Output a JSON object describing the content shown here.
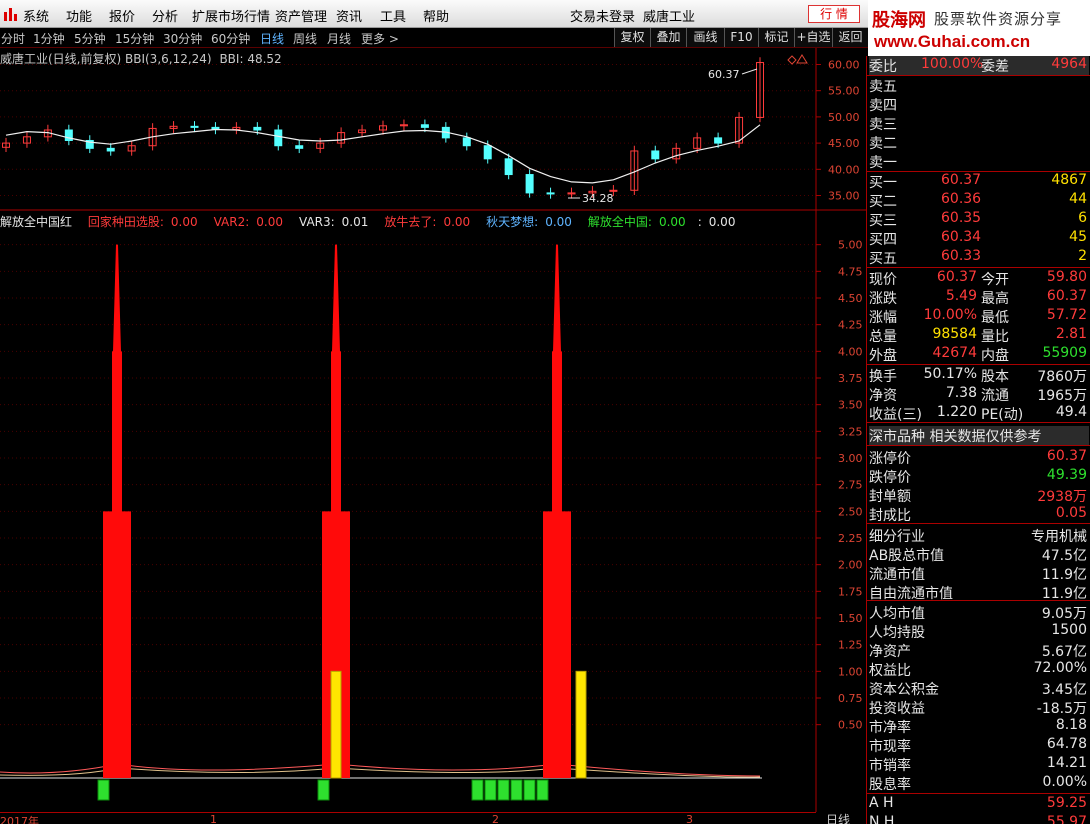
{
  "menu": {
    "items": [
      "系统",
      "功能",
      "报价",
      "分析",
      "扩展市场行情",
      "资产管理",
      "资讯",
      "工具",
      "帮助"
    ],
    "login_status": "交易未登录",
    "current_stock": "威唐工业",
    "hangqing_button": "行 情"
  },
  "brand": {
    "name": "股海网",
    "tagline": "股票软件资源分享",
    "url": "www.Guhai.com.cn"
  },
  "periods": {
    "items": [
      "分时",
      "1分钟",
      "5分钟",
      "15分钟",
      "30分钟",
      "60分钟",
      "日线",
      "周线",
      "月线",
      "更多 >"
    ],
    "active": "日线"
  },
  "toolbar": [
    "复权",
    "叠加",
    "画线",
    "F10",
    "标记",
    "+自选",
    "返回"
  ],
  "price_chart": {
    "header": "威唐工业(日线,前复权) BBI(3,6,12,24)",
    "bbi_label": "BBI: 48.52",
    "high_marker": "60.37",
    "low_marker": "34.28",
    "axis": [
      "60.00",
      "55.00",
      "50.00",
      "45.00",
      "40.00",
      "35.00"
    ]
  },
  "indicator": {
    "name": "解放全中国红",
    "lines": [
      {
        "label": "回家种田选股:",
        "value": "0.00",
        "color": "#ff3b3b"
      },
      {
        "label": "VAR2:",
        "value": "0.00",
        "color": "#ff3b3b"
      },
      {
        "label": "VAR3:",
        "value": "0.01",
        "color": "#e6e6e6"
      },
      {
        "label": "放牛去了:",
        "value": "0.00",
        "color": "#ff3b3b"
      },
      {
        "label": "秋天梦想:",
        "value": "0.00",
        "color": "#5fb4ff"
      },
      {
        "label": "解放全中国:",
        "value": "0.00",
        "color": "#2ee02e"
      },
      {
        "label": ":",
        "value": "0.00",
        "color": "#e6e6e6"
      }
    ],
    "axis": [
      "5.00",
      "4.75",
      "4.50",
      "4.25",
      "4.00",
      "3.75",
      "3.50",
      "3.25",
      "3.00",
      "2.75",
      "2.50",
      "2.25",
      "2.00",
      "1.75",
      "1.50",
      "1.25",
      "1.00",
      "0.75",
      "0.50"
    ]
  },
  "dates": [
    "2017年",
    "1",
    "2",
    "3"
  ],
  "period_tag": "日线",
  "quote": {
    "weibi": {
      "label": "委比",
      "value": "100.00%",
      "label2": "委差",
      "value2": "4964"
    },
    "sell": [
      {
        "label": "卖五",
        "price": "",
        "vol": ""
      },
      {
        "label": "卖四",
        "price": "",
        "vol": ""
      },
      {
        "label": "卖三",
        "price": "",
        "vol": ""
      },
      {
        "label": "卖二",
        "price": "",
        "vol": ""
      },
      {
        "label": "卖一",
        "price": "",
        "vol": ""
      }
    ],
    "buy": [
      {
        "label": "买一",
        "price": "60.37",
        "vol": "4867"
      },
      {
        "label": "买二",
        "price": "60.36",
        "vol": "44"
      },
      {
        "label": "买三",
        "price": "60.35",
        "vol": "6"
      },
      {
        "label": "买四",
        "price": "60.34",
        "vol": "45"
      },
      {
        "label": "买五",
        "price": "60.33",
        "vol": "2"
      }
    ],
    "stats": [
      {
        "l1": "现价",
        "v1": "60.37",
        "c1": "red",
        "l2": "今开",
        "v2": "59.80",
        "c2": "red"
      },
      {
        "l1": "涨跌",
        "v1": "5.49",
        "c1": "red",
        "l2": "最高",
        "v2": "60.37",
        "c2": "red"
      },
      {
        "l1": "涨幅",
        "v1": "10.00%",
        "c1": "red",
        "l2": "最低",
        "v2": "57.72",
        "c2": "red"
      },
      {
        "l1": "总量",
        "v1": "98584",
        "c1": "yellow",
        "l2": "量比",
        "v2": "2.81",
        "c2": "red"
      },
      {
        "l1": "外盘",
        "v1": "42674",
        "c1": "red",
        "l2": "内盘",
        "v2": "55909",
        "c2": "green"
      }
    ],
    "fundamentals": [
      {
        "l1": "换手",
        "v1": "50.17%",
        "l2": "股本",
        "v2": "7860万"
      },
      {
        "l1": "净资",
        "v1": "7.38",
        "l2": "流通",
        "v2": "1965万"
      },
      {
        "l1": "收益(三)",
        "v1": "1.220",
        "l2": "PE(动)",
        "v2": "49.4"
      }
    ],
    "market_note": "深市品种  相关数据仅供参考",
    "limits": [
      {
        "label": "涨停价",
        "value": "60.37",
        "color": "red"
      },
      {
        "label": "跌停价",
        "value": "49.39",
        "color": "green"
      },
      {
        "label": "封单额",
        "value": "2938万",
        "color": "red"
      },
      {
        "label": "封成比",
        "value": "0.05",
        "color": "red"
      }
    ],
    "company": [
      {
        "label": "细分行业",
        "value": "专用机械"
      },
      {
        "label": "AB股总市值",
        "value": "47.5亿"
      },
      {
        "label": "流通市值",
        "value": "11.9亿"
      },
      {
        "label": "自由流通市值",
        "value": "11.9亿"
      }
    ],
    "per_share": [
      {
        "label": "人均市值",
        "value": "9.05万"
      },
      {
        "label": "人均持股",
        "value": "1500"
      },
      {
        "label": "净资产",
        "value": "5.67亿"
      },
      {
        "label": "权益比",
        "value": "72.00%"
      },
      {
        "label": "资本公积金",
        "value": "3.45亿"
      },
      {
        "label": "投资收益",
        "value": "-18.5万"
      },
      {
        "label": "市净率",
        "value": "8.18"
      },
      {
        "label": "市现率",
        "value": "64.78"
      },
      {
        "label": "市销率",
        "value": "14.21"
      },
      {
        "label": "股息率",
        "value": "0.00%"
      }
    ],
    "ah": [
      {
        "label": "A H",
        "value": "59.25"
      },
      {
        "label": "N H",
        "value": "55.97"
      }
    ]
  },
  "chart_data": [
    {
      "type": "line",
      "title": "威唐工业(日线,前复权) BBI(3,6,12,24)",
      "note": "daily candlesticks with BBI line",
      "ylim": [
        33,
        62
      ],
      "series": [
        {
          "name": "BBI",
          "values": [
            46.5,
            47.2,
            47.0,
            46.0,
            45.2,
            44.8,
            45.4,
            46.2,
            46.8,
            47.2,
            47.6,
            47.5,
            47.0,
            46.3,
            45.6,
            45.4,
            45.6,
            46.2,
            46.8,
            47.3,
            47.4,
            47.1,
            46.2,
            44.8,
            42.6,
            40.2,
            38.6,
            37.6,
            37.4,
            38.0,
            39.5,
            41.2,
            42.6,
            43.6,
            44.4,
            45.4,
            48.5
          ]
        },
        {
          "name": "close",
          "values": [
            45.0,
            46.2,
            47.5,
            45.5,
            44.0,
            43.5,
            44.5,
            47.8,
            48.2,
            48.0,
            47.6,
            48.0,
            47.5,
            44.5,
            44.0,
            45.0,
            47.0,
            47.5,
            48.3,
            48.5,
            48.0,
            46.0,
            44.5,
            42.0,
            39.0,
            35.5,
            35.3,
            35.5,
            35.8,
            36.0,
            43.5,
            42.0,
            44.0,
            46.0,
            45.0,
            49.9,
            60.37
          ]
        }
      ],
      "annotations": [
        {
          "text": "60.37",
          "kind": "high"
        },
        {
          "text": "34.28",
          "kind": "low"
        }
      ]
    },
    {
      "type": "bar",
      "title": "解放全中国红",
      "ylim": [
        0,
        5.25
      ],
      "series": [
        {
          "name": "red spike peak",
          "values": [
            5.0,
            5.0,
            5.0
          ]
        },
        {
          "name": "red column",
          "values": [
            2.5,
            2.5,
            2.5
          ]
        },
        {
          "name": "yellow",
          "values": [
            1.0,
            1.0
          ]
        }
      ],
      "green_signal_bars": 8
    }
  ]
}
